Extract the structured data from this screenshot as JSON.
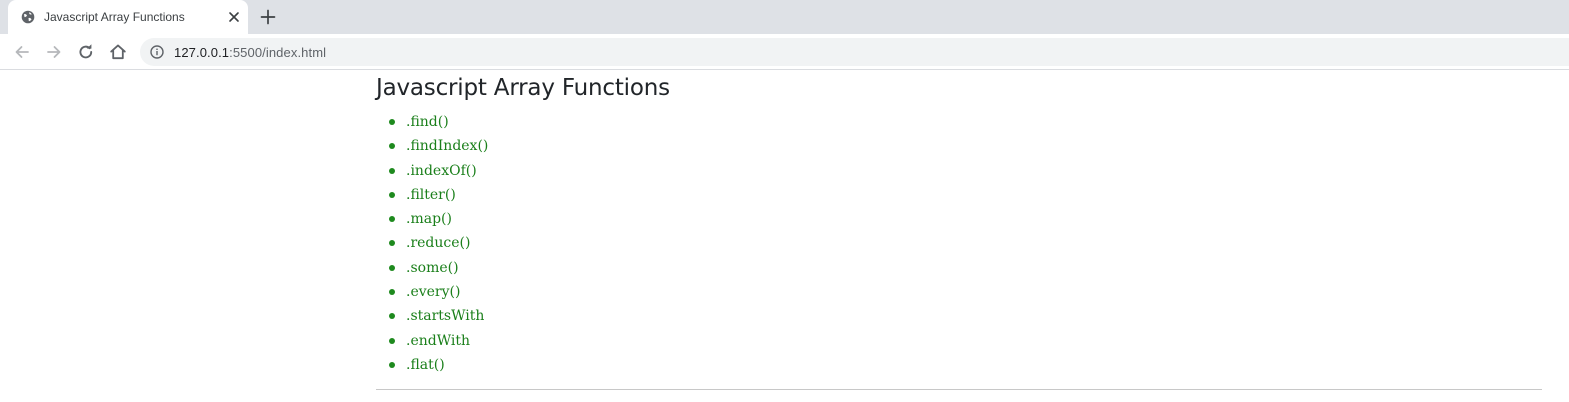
{
  "browser": {
    "tab_title": "Javascript Array Functions",
    "url_host": "127.0.0.1",
    "url_rest": ":5500/index.html"
  },
  "page": {
    "title": "Javascript Array Functions",
    "functions": [
      ".find()",
      ".findIndex()",
      ".indexOf()",
      ".filter()",
      ".map()",
      ".reduce()",
      ".some()",
      ".every()",
      ".startsWith",
      ".endWith",
      ".flat()"
    ]
  },
  "colors": {
    "link": "#1a7f1a",
    "heading": "#212529",
    "tabstrip": "#dee1e6"
  },
  "icons": {
    "tab_favicon": "globe-icon",
    "tab_close": "close-icon",
    "new_tab": "plus-icon",
    "back": "arrow-left-icon",
    "forward": "arrow-right-icon",
    "reload": "reload-icon",
    "home": "home-icon",
    "site_info": "info-icon"
  }
}
